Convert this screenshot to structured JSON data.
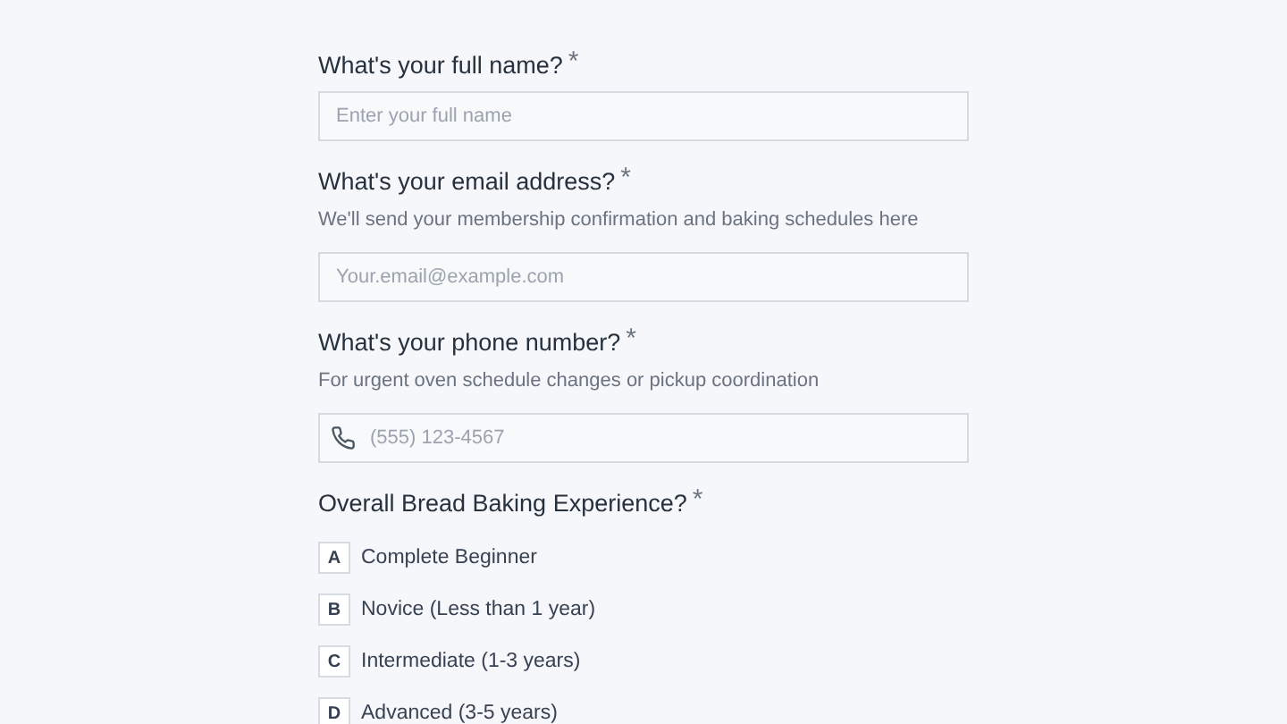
{
  "questions": [
    {
      "kind": "input",
      "title": "What's your full name?",
      "mark": "*",
      "field": {
        "kind": "text",
        "placeholder": "Enter your full name"
      }
    },
    {
      "kind": "input",
      "title": "What's your email address?",
      "mark": "*",
      "description": "We'll send your membership confirmation and baking schedules here",
      "field": {
        "kind": "text",
        "placeholder": "Your.email@example.com"
      }
    },
    {
      "kind": "input",
      "title": "What's your phone number?",
      "mark": "*",
      "description": "For urgent oven schedule changes or pickup coordination",
      "field": {
        "kind": "phone",
        "placeholder": "(555) 123-4567"
      }
    },
    {
      "kind": "choice",
      "title": "Overall Bread Baking Experience?",
      "mark": "*",
      "options": [
        {
          "key": "A",
          "label": "Complete Beginner",
          "selected": false
        },
        {
          "key": "B",
          "label": "Novice (Less than 1 year)",
          "selected": false
        },
        {
          "key": "C",
          "label": "Intermediate (1-3 years)",
          "selected": false
        },
        {
          "key": "D",
          "label": "Advanced (3-5 years)",
          "selected": false
        }
      ]
    }
  ]
}
